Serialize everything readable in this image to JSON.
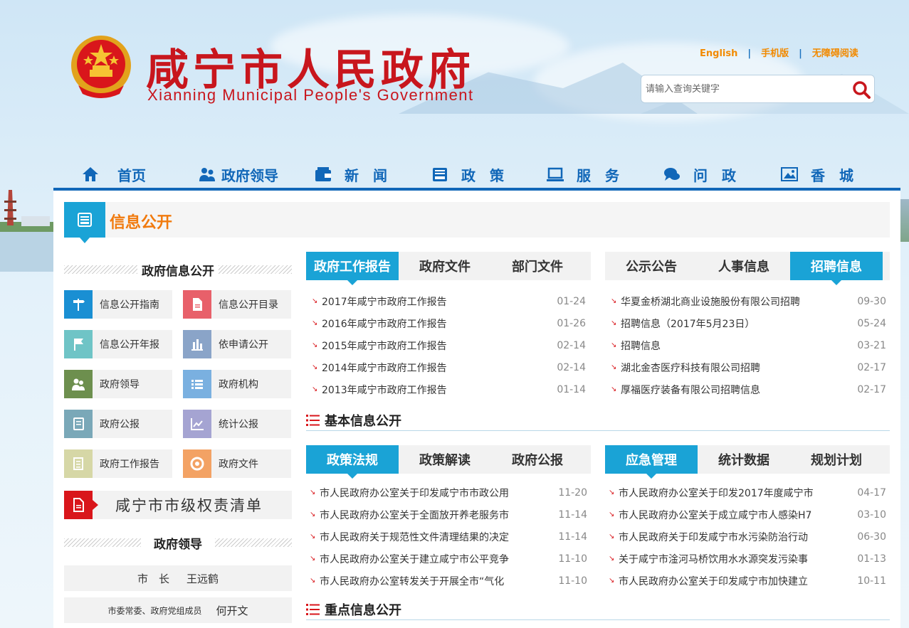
{
  "header": {
    "title_cn": "咸宁市人民政府",
    "title_en": "Xianning Municipal People's Government",
    "links": [
      "English",
      "手机版",
      "无障碍阅读"
    ],
    "search_placeholder": "请输入查询关键字"
  },
  "nav": {
    "items": [
      {
        "label": "首页",
        "icon": "home-icon"
      },
      {
        "label": "政府领导",
        "icon": "users-icon"
      },
      {
        "label": "新　闻",
        "icon": "wallet-icon"
      },
      {
        "label": "政　策",
        "icon": "inbox-icon"
      },
      {
        "label": "服　务",
        "icon": "laptop-icon"
      },
      {
        "label": "问　政",
        "icon": "chat-icon"
      },
      {
        "label": "香　城",
        "icon": "image-icon"
      }
    ]
  },
  "info": {
    "title": "信息公开"
  },
  "left": {
    "gov_info_title": "政府信息公开",
    "buttons": [
      {
        "label": "信息公开指南",
        "color": "#1a8fd3",
        "icon": "signpost-icon"
      },
      {
        "label": "信息公开目录",
        "color": "#e8606a",
        "icon": "document-icon"
      },
      {
        "label": "信息公开年报",
        "color": "#6fc4c6",
        "icon": "flag-icon"
      },
      {
        "label": "依申请公开",
        "color": "#8aa4c8",
        "icon": "building-icon"
      },
      {
        "label": "政府领导",
        "color": "#6d8f4e",
        "icon": "people-icon"
      },
      {
        "label": "政府机构",
        "color": "#7ab0e0",
        "icon": "list-icon"
      },
      {
        "label": "政府公报",
        "color": "#7aa8b8",
        "icon": "book-icon"
      },
      {
        "label": "统计公报",
        "color": "#a5a4d2",
        "icon": "chart-line-icon"
      },
      {
        "label": "政府工作报告",
        "color": "#d6d7a6",
        "icon": "notes-icon"
      },
      {
        "label": "政府文件",
        "color": "#f3a264",
        "icon": "lifebuoy-icon"
      }
    ],
    "power_list": "咸宁市市级权责清单",
    "leaders_title": "政府领导",
    "leaders": [
      {
        "role": "市　长",
        "name": "王远鹤"
      },
      {
        "role": "市委常委、政府党组成员",
        "name": "何开文"
      }
    ]
  },
  "box1": {
    "tabs": [
      "政府工作报告",
      "政府文件",
      "部门文件"
    ],
    "active": 0,
    "rows": [
      {
        "text": "2017年咸宁市政府工作报告",
        "date": "01-24"
      },
      {
        "text": "2016年咸宁市政府工作报告",
        "date": "01-26"
      },
      {
        "text": "2015年咸宁市政府工作报告",
        "date": "02-14"
      },
      {
        "text": "2014年咸宁市政府工作报告",
        "date": "02-14"
      },
      {
        "text": "2013年咸宁市政府工作报告",
        "date": "01-14"
      }
    ]
  },
  "box2": {
    "tabs": [
      "公示公告",
      "人事信息",
      "招聘信息"
    ],
    "active": 2,
    "rows": [
      {
        "text": "华夏金桥湖北商业设施股份有限公司招聘",
        "date": "09-30"
      },
      {
        "text": "招聘信息（2017年5月23日）",
        "date": "05-24"
      },
      {
        "text": "招聘信息",
        "date": "03-21"
      },
      {
        "text": "湖北金杏医疗科技有限公司招聘",
        "date": "02-17"
      },
      {
        "text": "厚福医疗装备有限公司招聘信息",
        "date": "02-17"
      }
    ]
  },
  "basic_title": "基本信息公开",
  "box3": {
    "tabs": [
      "政策法规",
      "政策解读",
      "政府公报"
    ],
    "active": 0,
    "rows": [
      {
        "text": "市人民政府办公室关于印发咸宁市市政公用",
        "date": "11-20"
      },
      {
        "text": "市人民政府办公室关于全面放开养老服务市",
        "date": "11-14"
      },
      {
        "text": "市人民政府关于规范性文件清理结果的决定",
        "date": "11-14"
      },
      {
        "text": "市人民政府办公室关于建立咸宁市公平竞争",
        "date": "11-10"
      },
      {
        "text": "市人民政府办公室转发关于开展全市“气化",
        "date": "11-10"
      }
    ]
  },
  "box4": {
    "tabs": [
      "应急管理",
      "统计数据",
      "规划计划"
    ],
    "active": 0,
    "rows": [
      {
        "text": "市人民政府办公室关于印发2017年度咸宁市",
        "date": "04-17"
      },
      {
        "text": "市人民政府办公室关于成立咸宁市人感染H7",
        "date": "03-10"
      },
      {
        "text": "市人民政府关于印发咸宁市水污染防治行动",
        "date": "06-30"
      },
      {
        "text": "关于咸宁市淦河马桥饮用水水源突发污染事",
        "date": "01-13"
      },
      {
        "text": "市人民政府办公室关于印发咸宁市加快建立",
        "date": "10-11"
      }
    ]
  },
  "key_title": "重点信息公开",
  "colors": {
    "brand_red": "#c8161d",
    "nav_blue": "#1167b8",
    "tab_blue": "#1aa3d6",
    "accent_orange": "#f17a0d"
  }
}
